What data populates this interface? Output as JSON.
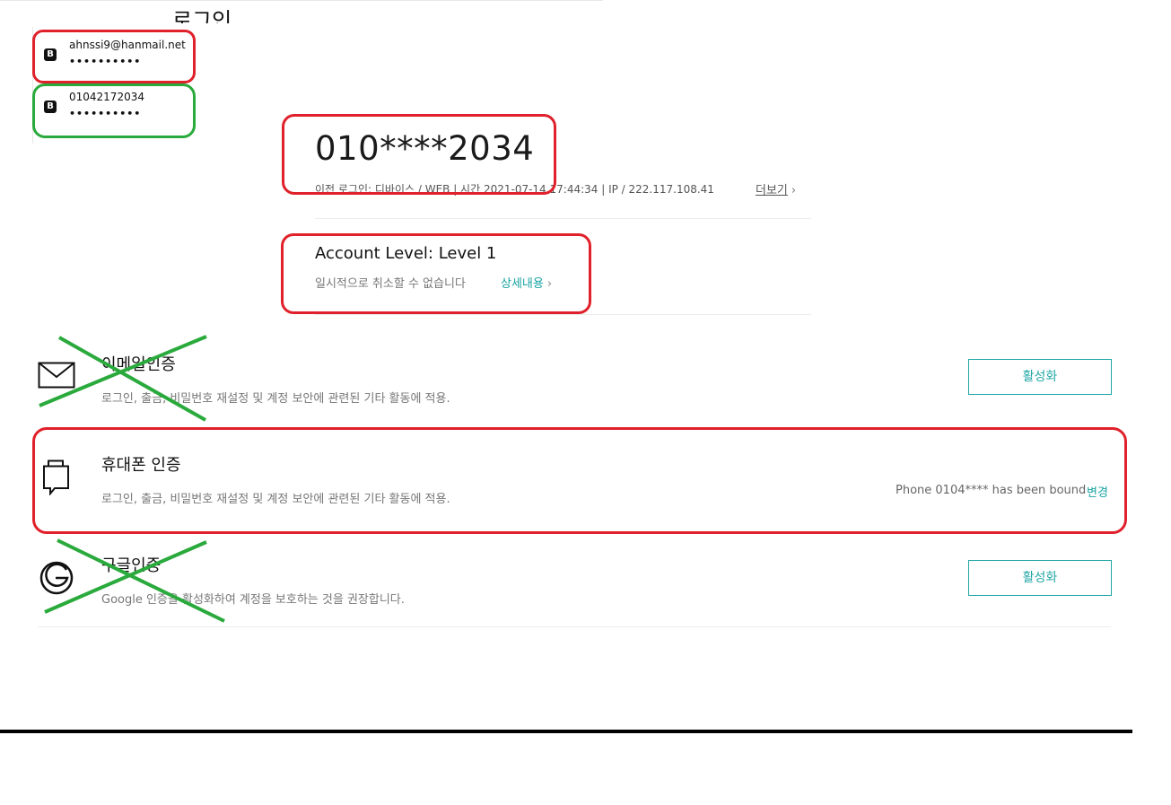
{
  "header": {
    "title_partial": "로그인"
  },
  "saved_accounts": [
    {
      "logo": "B",
      "id": "ahnssi9@hanmail.net",
      "password_mask": "••••••••••"
    },
    {
      "logo": "B",
      "id": "01042172034",
      "password_mask": "••••••••••"
    }
  ],
  "profile": {
    "masked_phone": "010****2034",
    "last_login": "이전 로그인: 디바이스 / WEB | 시간 2021-07-14 17:44:34 | IP / 222.117.108.41",
    "more_label": "더보기",
    "level_title": "Account Level: Level 1",
    "level_sub": "일시적으로 취소할 수 없습니다",
    "level_link": "상세내용"
  },
  "security": {
    "email": {
      "icon": "envelope-icon",
      "title": "이메일인증",
      "desc": "로그인, 출금, 비밀번호 재설정 및 계정 보안에 관련된 기타 활동에 적용.",
      "button": "활성화"
    },
    "phone": {
      "icon": "phone-icon",
      "title": "휴대폰 인증",
      "desc": "로그인, 출금, 비밀번호 재설정 및 계정 보안에 관련된 기타 활동에 적용.",
      "status": "Phone 0104**** has been bound",
      "change": "변경"
    },
    "google": {
      "icon": "google-auth-icon",
      "title": "구글인증",
      "desc": "Google 인증을 활성화하여 계정을 보호하는 것을 권장합니다.",
      "button": "활성화"
    }
  },
  "colors": {
    "accent": "#21a6a6",
    "highlight_red": "#e0202a",
    "highlight_green": "#2aaa3c"
  }
}
